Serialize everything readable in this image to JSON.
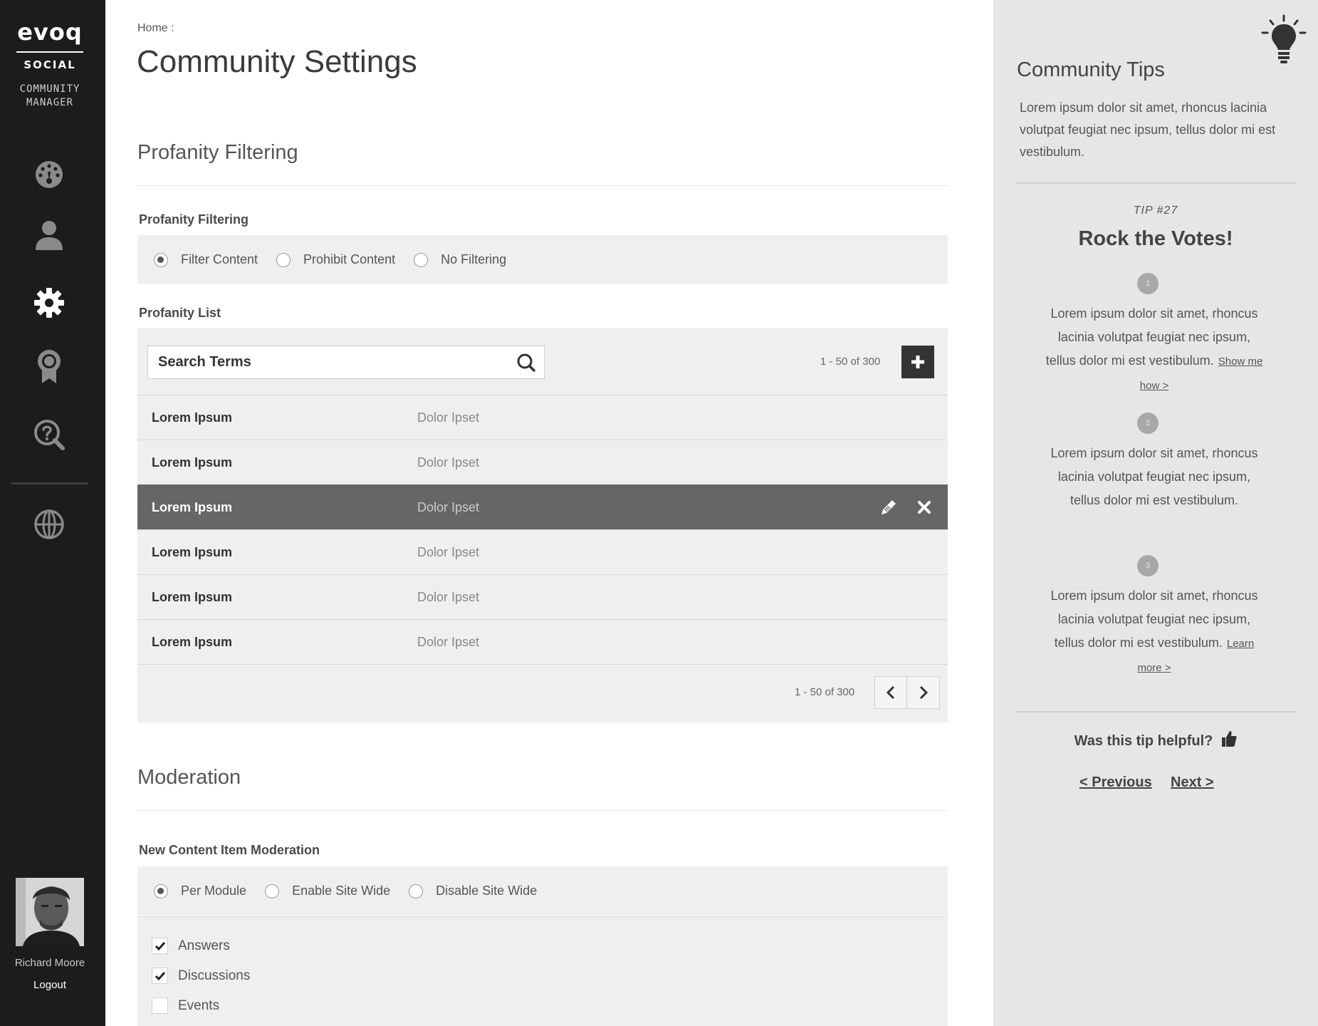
{
  "app": {
    "logo_text": "evoq",
    "logo_subtitle": "SOCIAL",
    "product_line1": "COMMUNITY",
    "product_line2": "MANAGER"
  },
  "sidebar": {
    "nav_icons": [
      "dashboard-icon",
      "user-icon",
      "gear-icon",
      "award-icon",
      "help-search-icon",
      "globe-icon"
    ],
    "active": "gear-icon",
    "user_name": "Richard Moore",
    "logout_label": "Logout"
  },
  "breadcrumb": "Home :",
  "page_title": "Community Settings",
  "profanity": {
    "section_title": "Profanity Filtering",
    "filter_label": "Profanity Filtering",
    "options": [
      "Filter Content",
      "Prohibit Content",
      "No Filtering"
    ],
    "selected": 0,
    "list_label": "Profanity List",
    "search_placeholder": "Search Terms",
    "count_top": "1 - 50 of 300",
    "rows": [
      {
        "term": "Lorem Ipsum",
        "replacement": "Dolor Ipset"
      },
      {
        "term": "Lorem Ipsum",
        "replacement": "Dolor Ipset"
      },
      {
        "term": "Lorem Ipsum",
        "replacement": "Dolor Ipset"
      },
      {
        "term": "Lorem Ipsum",
        "replacement": "Dolor Ipset"
      },
      {
        "term": "Lorem Ipsum",
        "replacement": "Dolor Ipset"
      },
      {
        "term": "Lorem Ipsum",
        "replacement": "Dolor Ipset"
      }
    ],
    "selected_row": 2,
    "count_bottom": "1 - 50 of 300"
  },
  "moderation": {
    "section_title": "Moderation",
    "label": "New Content Item Moderation",
    "options": [
      "Per Module",
      "Enable Site Wide",
      "Disable Site Wide"
    ],
    "selected": 0,
    "checkboxes": [
      {
        "label": "Answers",
        "checked": true
      },
      {
        "label": "Discussions",
        "checked": true
      },
      {
        "label": "Events",
        "checked": false
      }
    ]
  },
  "tips": {
    "title": "Community Tips",
    "intro": "Lorem ipsum dolor sit amet, rhoncus lacinia volutpat feugiat nec ipsum, tellus dolor mi est vestibulum.",
    "tip_number": "TIP #27",
    "heading": "Rock the Votes!",
    "steps": [
      {
        "badge": "1",
        "text": "Lorem ipsum dolor sit amet, rhoncus lacinia volutpat feugiat nec ipsum, tellus dolor mi est vestibulum.",
        "link": "Show me how >"
      },
      {
        "badge": "2",
        "text": "Lorem ipsum dolor sit amet, rhoncus lacinia volutpat feugiat nec ipsum, tellus dolor mi est vestibulum.",
        "link": ""
      },
      {
        "badge": "3",
        "text": "Lorem ipsum dolor sit amet, rhoncus lacinia volutpat feugiat nec ipsum, tellus dolor mi est vestibulum.",
        "link": "Learn more >"
      }
    ],
    "helpful_question": "Was this tip helpful?",
    "previous_label": "< Previous",
    "next_label": "Next >"
  },
  "colors": {
    "sidebar_bg": "#1c1c1c",
    "tips_bg": "#e6e6e6",
    "panel_bg": "#efefef",
    "selected_row_bg": "#666666"
  }
}
